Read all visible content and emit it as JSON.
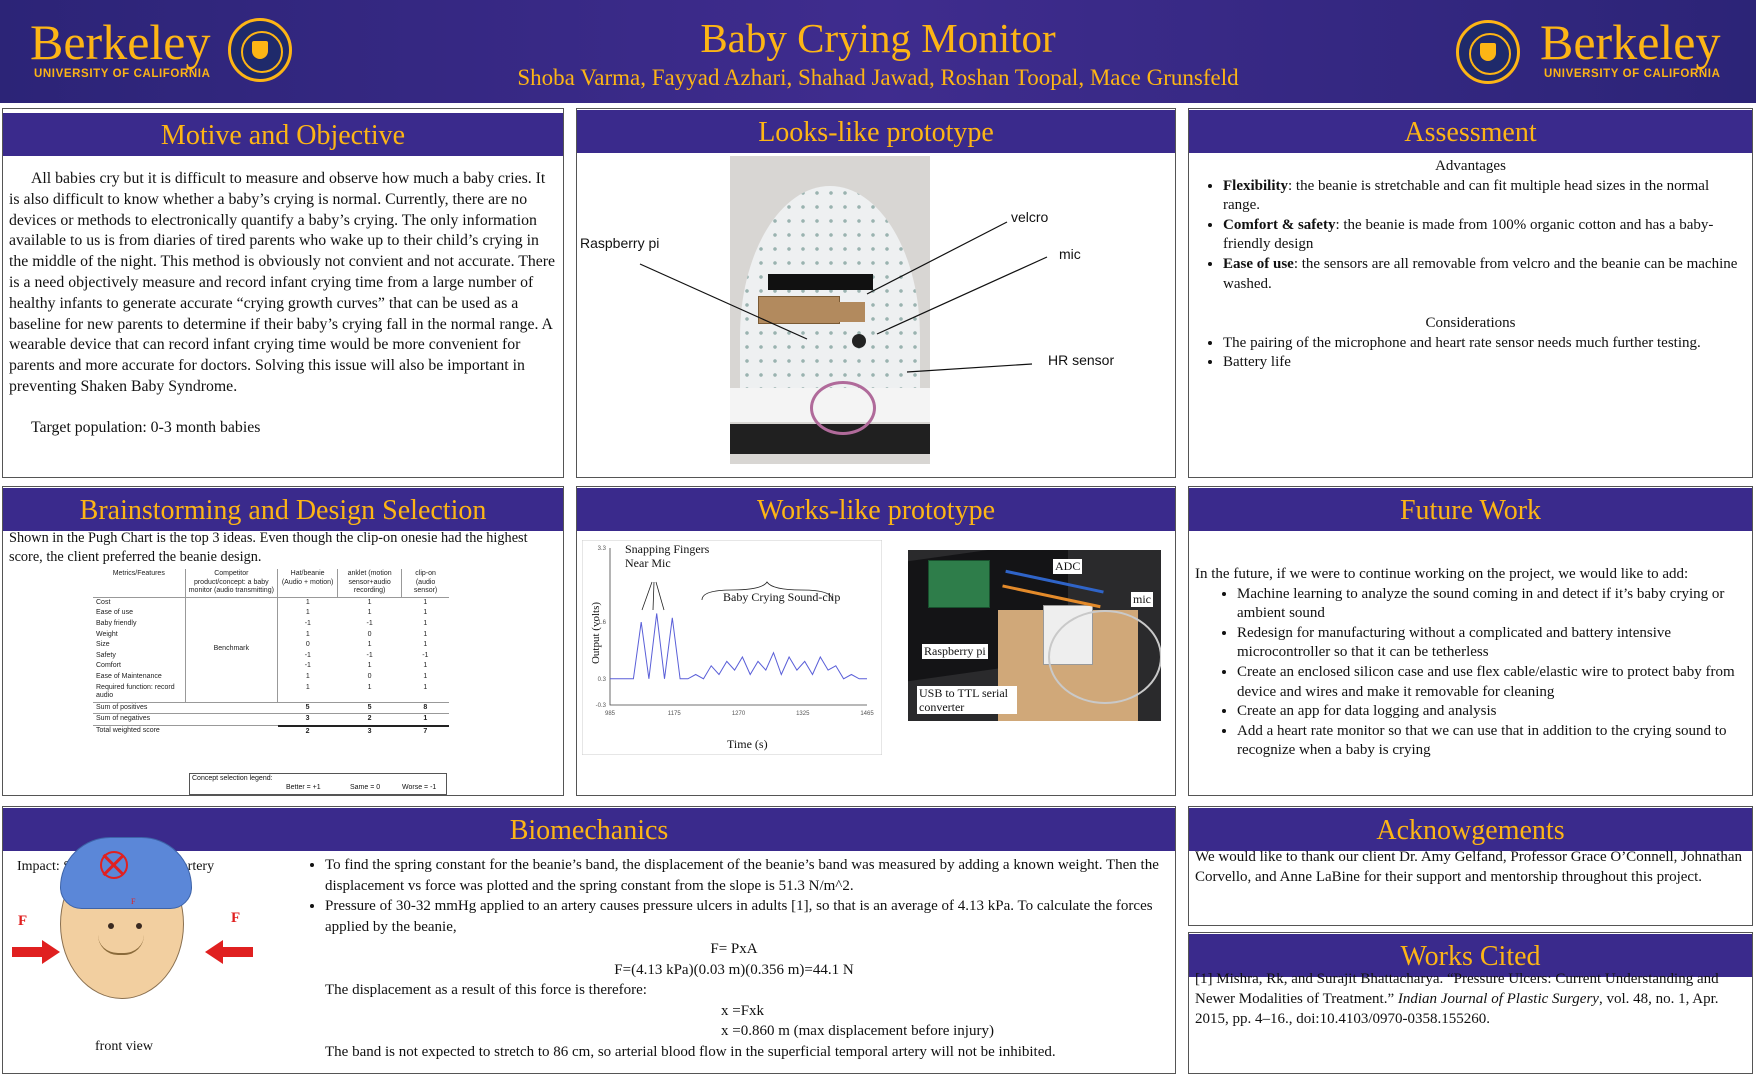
{
  "header": {
    "title": "Baby Crying Monitor",
    "authors": "Shoba Varma, Fayyad Azhari, Shahad Jawad, Roshan Toopal, Mace Grunsfeld",
    "logo_word": "Berkeley",
    "logo_sub": "UNIVERSITY OF CALIFORNIA"
  },
  "colors": {
    "header_bg": "#3a2a8c",
    "accent_gold": "#fdb515"
  },
  "motive": {
    "heading": "Motive and Objective",
    "paragraph": "All babies cry but it is difficult to measure and observe how much a baby cries. It is also difficult to know whether a baby’s crying is normal. Currently, there are no devices or methods to electronically quantify a baby’s crying. The only information available to us is from diaries of tired parents who wake up to their child’s crying in the middle of the night. This method is obviously not convient and not accurate. There is a need objectively measure and record infant crying time from a large number of healthy infants to generate accurate “crying growth curves” that can be used as a baseline for new parents to determine if their baby’s crying fall in the normal range. A wearable device that can record infant crying time would be more convenient for parents and more accurate for doctors. Solving this issue will also be important in preventing Shaken Baby Syndrome.",
    "target": "Target population: 0-3 month babies"
  },
  "looks_like": {
    "heading": "Looks-like prototype",
    "labels": {
      "raspberry": "Raspberry pi",
      "velcro": "velcro",
      "mic": "mic",
      "hr": "HR sensor"
    }
  },
  "assessment": {
    "heading": "Assessment",
    "advantages_title": "Advantages",
    "advantages": [
      {
        "term": "Flexibility",
        "text": ": the beanie is stretchable and can fit multiple head sizes in the normal range."
      },
      {
        "term": "Comfort & safety",
        "text": ": the beanie is made from 100% organic cotton and has a baby-friendly design"
      },
      {
        "term": "Ease of use",
        "text": ": the sensors are all removable from velcro and the beanie can be machine washed."
      }
    ],
    "considerations_title": "Considerations",
    "considerations": [
      "The pairing of the microphone and heart rate sensor needs much further testing.",
      "Battery life"
    ]
  },
  "brainstorm": {
    "heading": "Brainstorming and Design Selection",
    "intro": "Shown in the Pugh Chart is the top 3 ideas. Even though the clip-on onesie had the highest score, the client preferred the beanie design.",
    "table": {
      "headers": [
        "Metrics/Features",
        "Competitor product/concept: a baby monitor (audio transmitting)",
        "Hat/beanie (Audio + motion)",
        "anklet (motion sensor+audio recording)",
        "clip-on (audio sensor)"
      ],
      "benchmark": "Benchmark",
      "rows": [
        [
          "Cost",
          "1",
          "1",
          "1"
        ],
        [
          "Ease of use",
          "1",
          "1",
          "1"
        ],
        [
          "Baby friendly",
          "-1",
          "-1",
          "1"
        ],
        [
          "Weight",
          "1",
          "0",
          "1"
        ],
        [
          "Size",
          "0",
          "1",
          "1"
        ],
        [
          "Safety",
          "-1",
          "-1",
          "-1"
        ],
        [
          "Comfort",
          "-1",
          "1",
          "1"
        ],
        [
          "Ease of Maintenance",
          "1",
          "0",
          "1"
        ],
        [
          "Required function: record audio",
          "1",
          "1",
          "1"
        ]
      ],
      "totals": [
        [
          "Sum of positives",
          "5",
          "5",
          "8"
        ],
        [
          "Sum of negatives",
          "3",
          "2",
          "1"
        ],
        [
          "Total weighted score",
          "2",
          "3",
          "7"
        ]
      ],
      "legend": {
        "label": "Concept selection legend:",
        "better": "Better = +1",
        "same": "Same = 0",
        "worse": "Worse = -1"
      }
    }
  },
  "works_like": {
    "heading": "Works-like prototype",
    "annotations": {
      "snap": "Snapping Fingers Near Mic",
      "cry": "Baby Crying Sound-clip"
    },
    "photo_labels": {
      "adc": "ADC",
      "mic": "mic",
      "raspberry": "Raspberry pi",
      "usb": "USB to TTL serial converter"
    }
  },
  "chart_data": {
    "type": "line",
    "title": "",
    "xlabel": "Time (s)",
    "ylabel": "Output (volts)",
    "xticks": [
      "985",
      "1175",
      "1270",
      "1325",
      "1465"
    ],
    "yticks": [
      "3.3",
      "1.6",
      "0.3",
      "-0.3"
    ],
    "series": [
      {
        "values": [
          0.3,
          0.3,
          0.3,
          0.3,
          1.6,
          0.3,
          1.8,
          0.3,
          1.7,
          0.3,
          0.3,
          0.4,
          0.3,
          0.6,
          0.4,
          0.7,
          0.5,
          0.8,
          0.4,
          0.7,
          0.5,
          0.9,
          0.4,
          0.8,
          0.5,
          0.7,
          0.4,
          0.8,
          0.5,
          0.6,
          0.3,
          0.4,
          0.3,
          0.3
        ]
      }
    ]
  },
  "future": {
    "heading": "Future Work",
    "intro": "In the future, if we were to continue working on the project, we would like to add:",
    "items": [
      "Machine learning to analyze the sound coming in and detect if it’s baby crying or ambient sound",
      "Redesign for manufacturing without a complicated and battery intensive microcontroller so that it can be tetherless",
      "Create an enclosed silicon case and use flex cable/elastic wire to protect baby from device and wires and make it removable for cleaning",
      "Create an app for data logging and analysis",
      "Add a heart rate monitor so that we can use that in addition to the crying sound to recognize when a baby is crying"
    ]
  },
  "biomech": {
    "heading": "Biomechanics",
    "impact": "Impact: Superficial temporal artery",
    "front_view": "front view",
    "force_label": "F",
    "bullet1": "To find the spring constant for the beanie’s band, the displacement of the beanie’s band was measured by adding a known weight. Then the displacement vs force was plotted and the spring constant from the slope is 51.3 N/m^2.",
    "bullet2": "Pressure of 30-32 mmHg applied to an artery causes pressure ulcers in adults [1], so that is an average of 4.13 kPa. To calculate the forces applied by the beanie,",
    "eq1": "F= PxA",
    "eq2": "F=(4.13 kPa)(0.03 m)(0.356 m)=44.1 N",
    "disp_text": "The displacement as a result of this force is therefore:",
    "eq3": "x =Fxk",
    "eq4": "x =0.860 m (max displacement before injury)",
    "conclusion": "The band is not expected to stretch to 86 cm, so arterial blood flow in the superficial temporal artery will not be inhibited."
  },
  "ack": {
    "heading": "Acknowgements",
    "text": "We would like to thank our client Dr. Amy Gelfand, Professor Grace O’Connell, Johnathan Corvello, and Anne LaBine for their support and mentorship throughout this project."
  },
  "cited": {
    "heading": "Works Cited",
    "pre": "[1] Mishra, Rk, and Surajit Bhattacharya. “Pressure Ulcers: Current Understanding and Newer Modalities of Treatment.” ",
    "journal": "Indian Journal of Plastic Surgery",
    "post": ", vol. 48, no. 1, Apr. 2015, pp. 4–16., doi:10.4103/0970-0358.155260."
  }
}
